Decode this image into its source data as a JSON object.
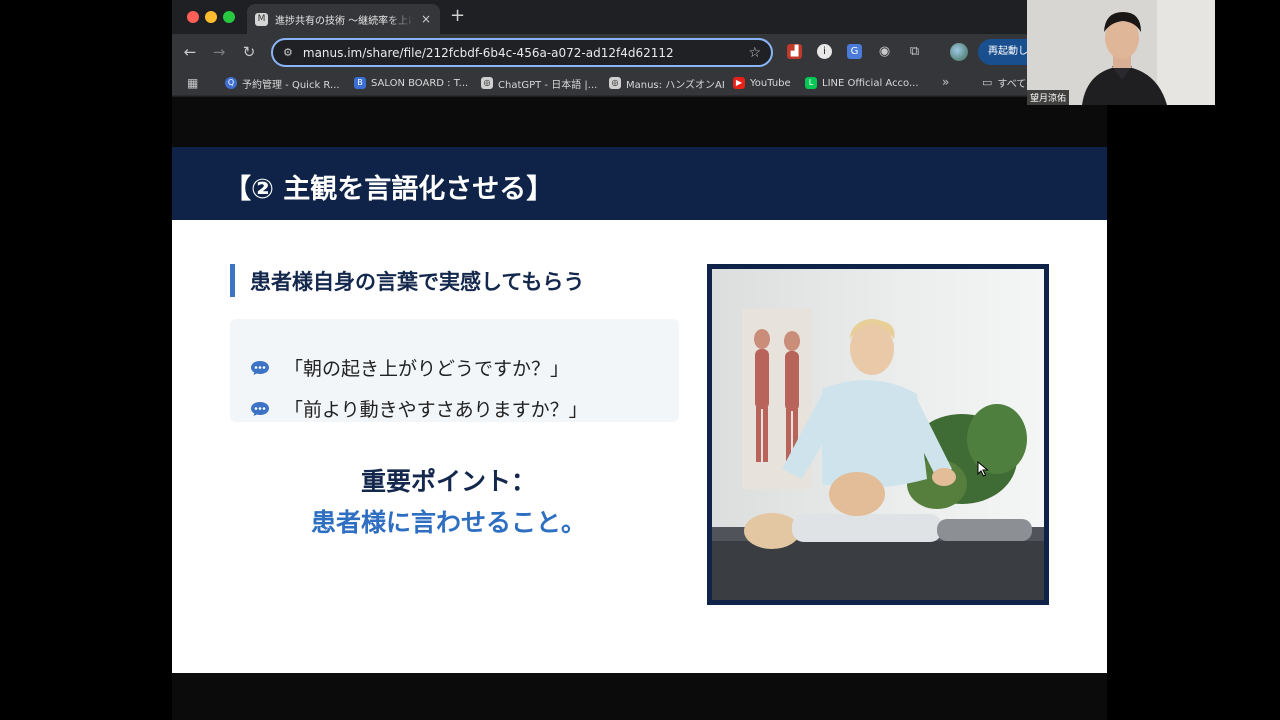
{
  "browser": {
    "tab": {
      "favicon": "M",
      "title": "進捗共有の技術 〜継続率を上げる",
      "close_glyph": "×"
    },
    "new_tab_glyph": "+",
    "nav": {
      "back_glyph": "←",
      "forward_glyph": "→",
      "reload_glyph": "↻"
    },
    "omnibox": {
      "site_info_glyph": "⚙",
      "url": "manus.im/share/file/212fcbdf-6b4c-456a-a072-ad12f4d62112",
      "star_glyph": "☆"
    },
    "extensions": [
      {
        "name": "chart-extension-icon",
        "glyph": "▟",
        "color": "#c0392b"
      },
      {
        "name": "info-extension-icon",
        "glyph": "i",
        "color": "#e8e8e8"
      },
      {
        "name": "translate-extension-icon",
        "glyph": "G",
        "color": "#4a7bd8"
      },
      {
        "name": "camera-extension-icon",
        "glyph": "◉",
        "color": "#c8c8c8"
      },
      {
        "name": "puzzle-extension-icon",
        "glyph": "⧉",
        "color": "#c8c8c8"
      }
    ],
    "relaunch_label": "再起動し",
    "bookmarks": {
      "apps_glyph": "▦",
      "items": [
        {
          "icon": "Q",
          "label": "予約管理 - Quick R..."
        },
        {
          "icon": "B",
          "label": "SALON BOARD : T..."
        },
        {
          "icon": "◎",
          "label": "ChatGPT - 日本語 |..."
        },
        {
          "icon": "◎",
          "label": "Manus: ハンズオンAI"
        },
        {
          "icon": "▶",
          "label": "YouTube"
        },
        {
          "icon": "L",
          "label": "LINE Official Acco..."
        }
      ],
      "more_glyph": "»",
      "folder_glyph": "▭",
      "folder_label": "すべて"
    }
  },
  "slide": {
    "title": "【② 主観を言語化させる】",
    "subtitle": "患者様自身の言葉で実感してもらう",
    "quotes": [
      "「朝の起き上がりどうですか？」",
      "「前より動きやすさありますか？」"
    ],
    "point_label": "重要ポイント：",
    "point_text": "患者様に言わせること。"
  },
  "webcam": {
    "name": "望月涼佑"
  },
  "colors": {
    "header_navy": "#0e2347",
    "accent_blue": "#3d73c4",
    "point_blue": "#2f6fc1",
    "omnibox_focus": "#8ab4f8"
  }
}
